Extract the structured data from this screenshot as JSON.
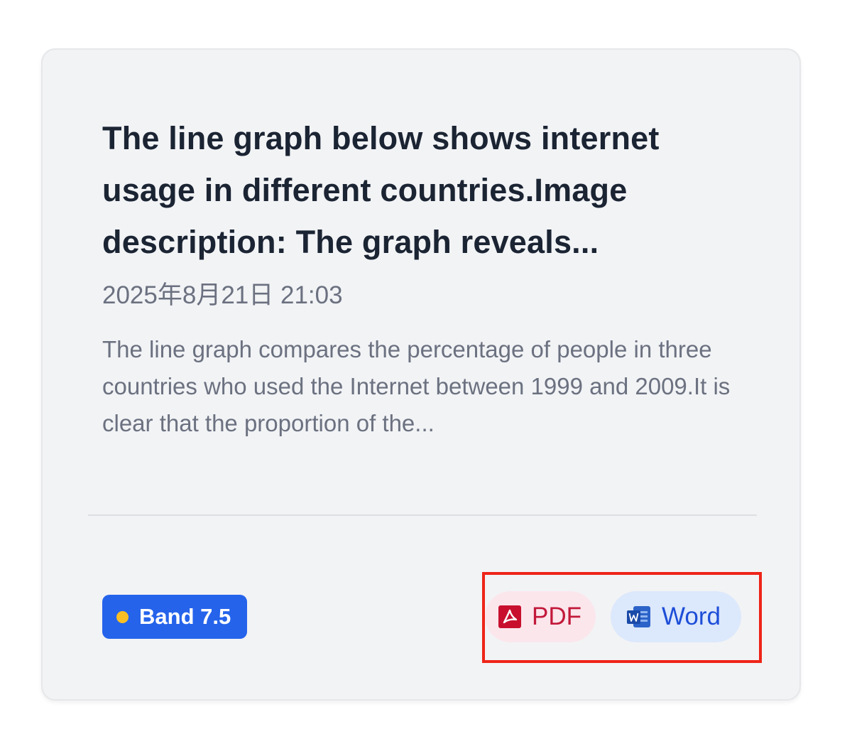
{
  "card": {
    "title": "The line graph below shows internet usage in different countries.Image description: The graph reveals...",
    "date": "2025年8月21日 21:03",
    "excerpt": "The line graph compares the percentage of people in three countries who used the Internet between 1999 and 2009.It is clear that the proportion of the...",
    "band": {
      "label": "Band 7.5",
      "dot_icon": "status-dot",
      "dot_color": "#fbbf24",
      "background": "#2563eb"
    },
    "downloads": {
      "pdf": {
        "label": "PDF",
        "icon": "pdf-icon",
        "color": "#c2193a"
      },
      "word": {
        "label": "Word",
        "icon": "word-icon",
        "color": "#1d4ed8"
      }
    },
    "highlight_color": "#ee2418"
  }
}
